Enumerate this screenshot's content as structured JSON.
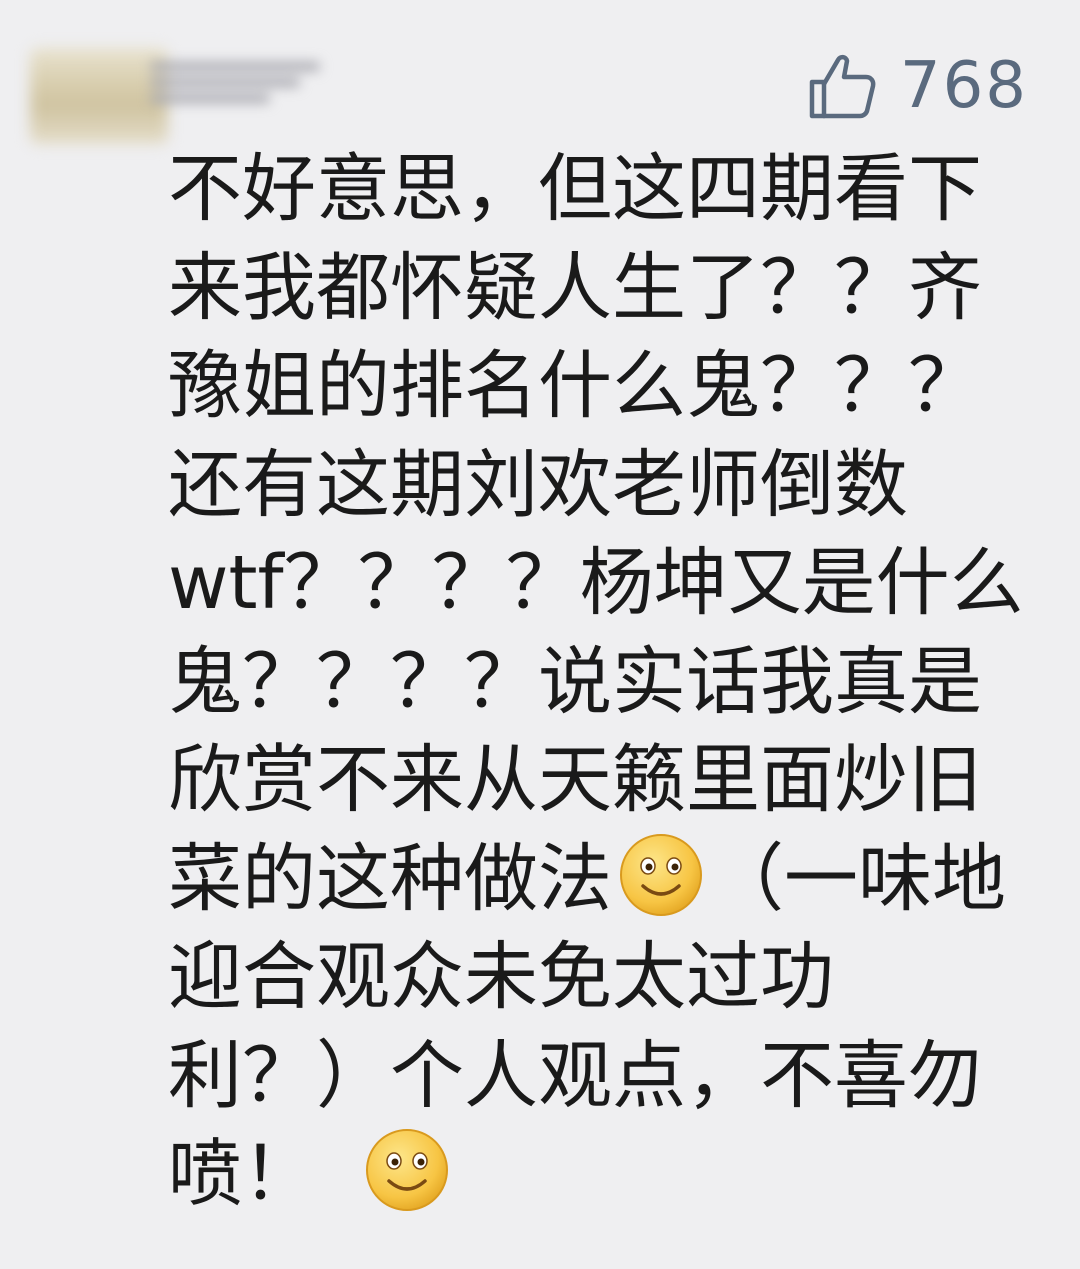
{
  "comment": {
    "like_count": "768",
    "icons": {
      "like": "thumbs-up-icon",
      "emoji": "smile-emoji-icon"
    },
    "text_segments": [
      "不好意思，但这四期看下\n来我都怀疑人生了？？齐\n豫姐的排名什么鬼？？？\n还有这期刘欢老师倒数\nwtf？？？？杨坤又是什么\n鬼？？？？说实话我真是\n欣赏不来从天籁里面炒旧\n菜的这种做法",
      "（一味地\n迎合观众未免太过功\n利？）个人观点，不喜勿\n喷！"
    ]
  },
  "colors": {
    "background": "#efeff1",
    "text": "#1a1a1a",
    "like": "#5a6a7e",
    "emoji_face": "#f7c544"
  }
}
